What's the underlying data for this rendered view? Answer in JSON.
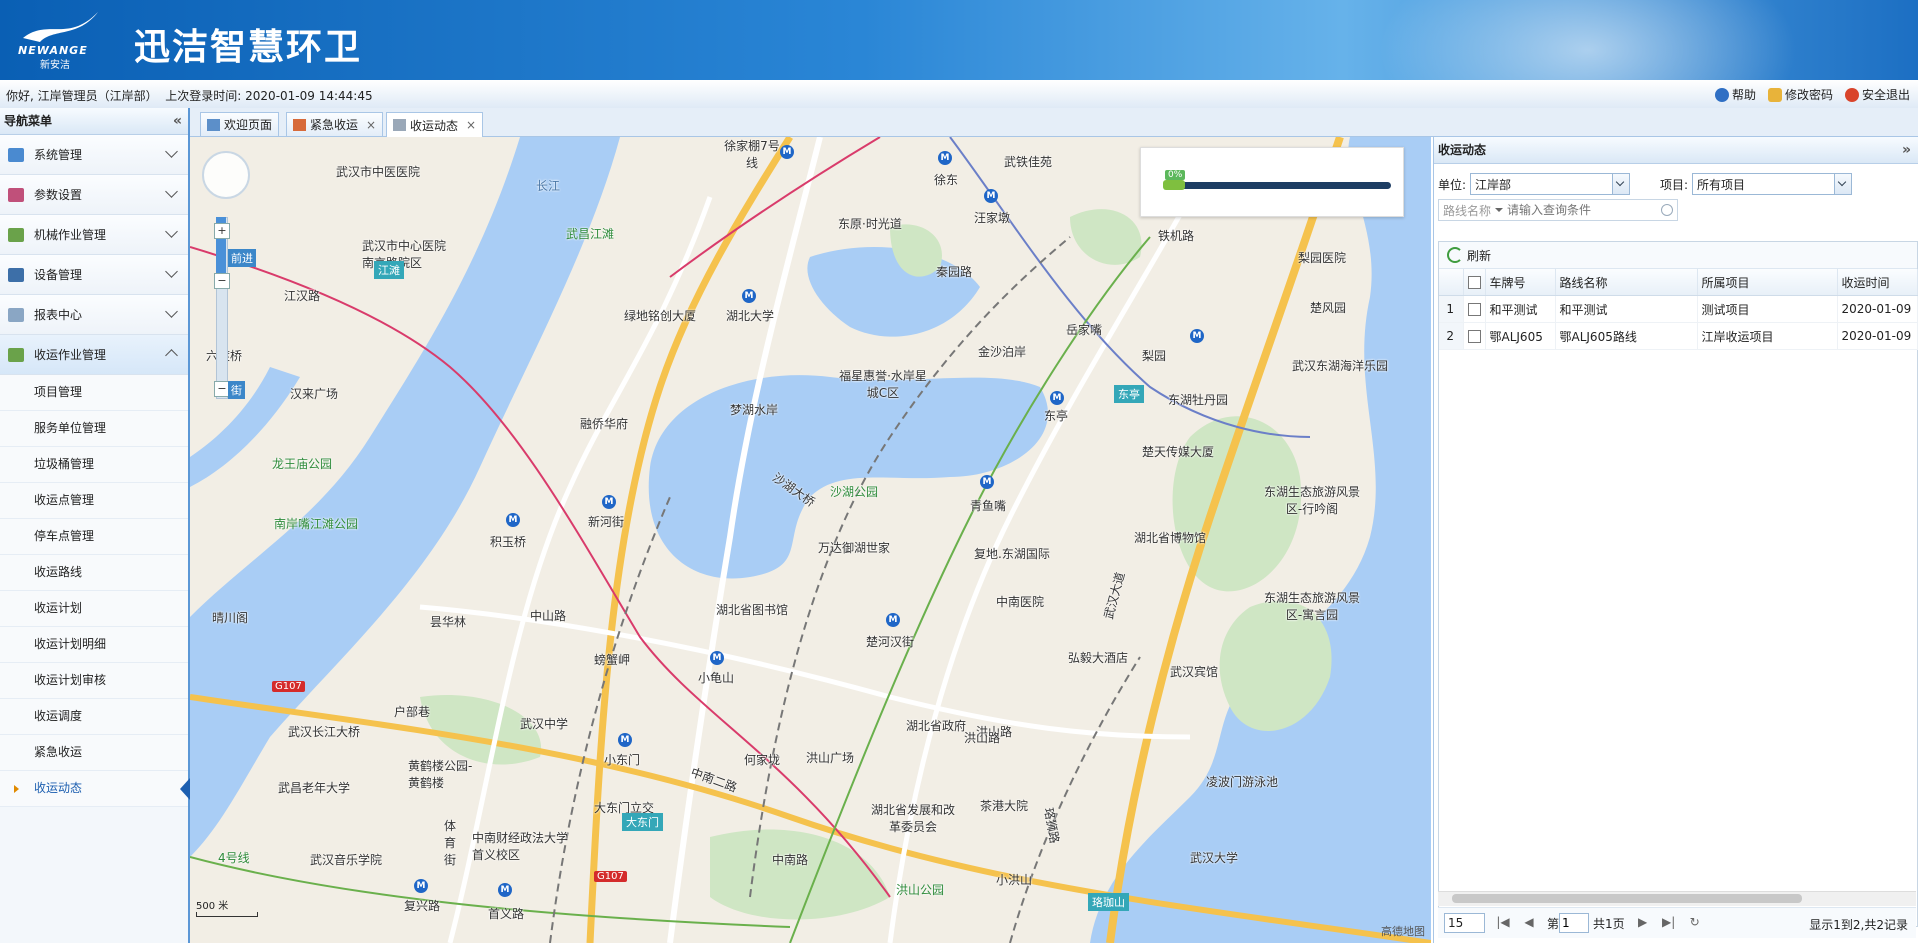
{
  "header": {
    "logo_en": "NEWANGE",
    "logo_cn": "新安洁",
    "app_title": "迅洁智慧环卫",
    "brand_color": "#1c6fc3"
  },
  "infobar": {
    "greeting": "你好, 江岸管理员（江岸部）",
    "last_login_label": "上次登录时间:",
    "last_login_time": "2020-01-09 14:44:45",
    "help": "帮助",
    "change_password": "修改密码",
    "logout": "安全退出"
  },
  "sidebar": {
    "title": "导航菜单",
    "menus": [
      {
        "label": "系统管理",
        "icon": "gear-icon"
      },
      {
        "label": "参数设置",
        "icon": "chart-icon"
      },
      {
        "label": "机械作业管理",
        "icon": "truck-icon"
      },
      {
        "label": "设备管理",
        "icon": "monitor-icon"
      },
      {
        "label": "报表中心",
        "icon": "report-icon"
      },
      {
        "label": "收运作业管理",
        "icon": "truck-icon"
      }
    ],
    "sub_items": [
      {
        "label": "项目管理"
      },
      {
        "label": "服务单位管理"
      },
      {
        "label": "垃圾桶管理"
      },
      {
        "label": "收运点管理"
      },
      {
        "label": "停车点管理"
      },
      {
        "label": "收运路线"
      },
      {
        "label": "收运计划"
      },
      {
        "label": "收运计划明细"
      },
      {
        "label": "收运计划审核"
      },
      {
        "label": "收运调度"
      },
      {
        "label": "紧急收运"
      },
      {
        "label": "收运动态"
      }
    ]
  },
  "tabs": [
    {
      "label": "欢迎页面",
      "icon": "home-icon"
    },
    {
      "label": "紧急收运",
      "icon": "alert-icon"
    },
    {
      "label": "收运动态",
      "icon": "document-icon"
    }
  ],
  "map": {
    "progress_label": "0%",
    "progress_value": 0,
    "zoom_forward": "前进",
    "zoom_street": "街",
    "scale_label": "500 米",
    "credit": "高德地图",
    "area_badges": [
      "江滩",
      "东亭",
      "大东门",
      "珞珈山"
    ],
    "road_badges": [
      "G107",
      "G107"
    ],
    "pois": [
      {
        "label": "武汉市中医医院"
      },
      {
        "label": "武汉市中心医院南京路院区"
      },
      {
        "label": "江汉路"
      },
      {
        "label": "六渡桥"
      },
      {
        "label": "汉来广场"
      },
      {
        "label": "龙王庙公园"
      },
      {
        "label": "南岸嘴江滩公园"
      },
      {
        "label": "晴川阁"
      },
      {
        "label": "武汉长江大桥"
      },
      {
        "label": "武昌老年大学"
      },
      {
        "label": "武汉音乐学院"
      },
      {
        "label": "复兴路"
      },
      {
        "label": "首义路"
      },
      {
        "label": "黄鹤楼公园-黄鹤楼"
      },
      {
        "label": "中南财经政法大学首义校区"
      },
      {
        "label": "武汉中学"
      },
      {
        "label": "户部巷"
      },
      {
        "label": "昙华林"
      },
      {
        "label": "螃蟹岬"
      },
      {
        "label": "积玉桥"
      },
      {
        "label": "新河街"
      },
      {
        "label": "融侨华府"
      },
      {
        "label": "武昌江滩"
      },
      {
        "label": "绿地铭创大厦"
      },
      {
        "label": "湖北大学"
      },
      {
        "label": "梦湖水岸"
      },
      {
        "label": "东原·时光道"
      },
      {
        "label": "徐家棚7号线"
      },
      {
        "label": "徐东"
      },
      {
        "label": "武铁佳苑"
      },
      {
        "label": "汪家墩"
      },
      {
        "label": "秦园路"
      },
      {
        "label": "金沙泊岸"
      },
      {
        "label": "福星惠誉·水岸星城C区"
      },
      {
        "label": "岳家嘴"
      },
      {
        "label": "梨园"
      },
      {
        "label": "铁机路"
      },
      {
        "label": "梨园医院"
      },
      {
        "label": "楚风园"
      },
      {
        "label": "武汉东湖海洋乐园"
      },
      {
        "label": "东湖牡丹园"
      },
      {
        "label": "东亭"
      },
      {
        "label": "楚天传媒大厦"
      },
      {
        "label": "沙湖公园"
      },
      {
        "label": "青鱼嘴"
      },
      {
        "label": "万达御湖世家"
      },
      {
        "label": "复地.东湖国际"
      },
      {
        "label": "湖北省博物馆"
      },
      {
        "label": "东湖生态旅游风景区-行吟阁"
      },
      {
        "label": "东湖生态旅游风景区-寓言园"
      },
      {
        "label": "中南医院"
      },
      {
        "label": "湖北省图书馆"
      },
      {
        "label": "楚河汉街"
      },
      {
        "label": "小龟山"
      },
      {
        "label": "弘毅大酒店"
      },
      {
        "label": "武汉宾馆"
      },
      {
        "label": "湖北省政府"
      },
      {
        "label": "洪山路"
      },
      {
        "label": "洪山广场"
      },
      {
        "label": "何家垅"
      },
      {
        "label": "小东门"
      },
      {
        "label": "大东门立交"
      },
      {
        "label": "中南路"
      },
      {
        "label": "湖北省发展和改革委员会"
      },
      {
        "label": "茶港大院"
      },
      {
        "label": "凌波门游泳池"
      },
      {
        "label": "武汉大学"
      },
      {
        "label": "洪山公园"
      },
      {
        "label": "小洪山"
      },
      {
        "label": "中山路"
      },
      {
        "label": "沙湖大桥"
      },
      {
        "label": "中南二路"
      },
      {
        "label": "武汉大道"
      },
      {
        "label": "珞狮路"
      },
      {
        "label": "洪山路"
      },
      {
        "label": "长江"
      },
      {
        "label": "体育街"
      },
      {
        "label": "4号线"
      }
    ]
  },
  "right_panel": {
    "title": "收运动态",
    "unit_label": "单位:",
    "unit_value": "江岸部",
    "project_label": "项目:",
    "project_value": "所有项目",
    "search_field": "路线名称",
    "search_placeholder": "请输入查询条件",
    "refresh_label": "刷新",
    "columns": [
      "车牌号",
      "路线名称",
      "所属项目",
      "收运时间"
    ],
    "rows": [
      {
        "no": "1",
        "plate": "和平测试",
        "route": "和平测试",
        "project": "测试项目",
        "time": "2020-01-09"
      },
      {
        "no": "2",
        "plate": "鄂ALJ605",
        "route": "鄂ALJ605路线",
        "project": "江岸收运项目",
        "time": "2020-01-09"
      }
    ],
    "pager": {
      "page_size": "15",
      "page_prefix": "第",
      "page_value": "1",
      "page_suffix": "共1页",
      "summary": "显示1到2,共2记录"
    }
  }
}
